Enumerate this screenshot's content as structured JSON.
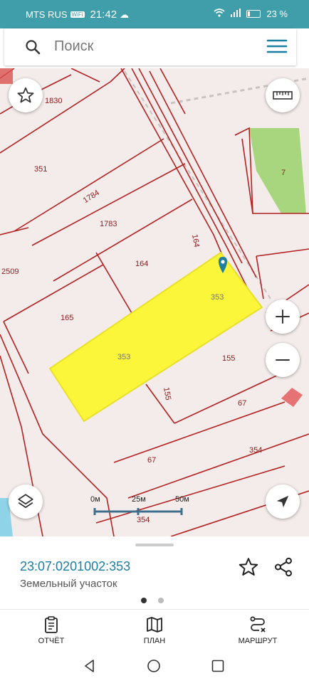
{
  "status": {
    "carrier": "MTS RUS",
    "wifi_badge": "WiFi",
    "time": "21:42",
    "battery": "23 %"
  },
  "search": {
    "placeholder": "Поиск"
  },
  "map": {
    "parcel_labels": [
      "1830",
      "351",
      "1784",
      "1783",
      "2509",
      "164",
      "164",
      "165",
      "353",
      "353",
      "155",
      "155",
      "67",
      "67",
      "354",
      "354",
      "7"
    ]
  },
  "scale": {
    "ticks": [
      "0м",
      "25м",
      "50м"
    ]
  },
  "sheet": {
    "cadastral_number": "23:07:0201002:353",
    "type": "Земельный участок"
  },
  "navbar": {
    "report": "ОТЧЁТ",
    "plan": "ПЛАН",
    "route": "МАРШРУТ"
  },
  "colors": {
    "accent": "#3f9ea9",
    "parcel_highlight": "#fbf63a",
    "boundary": "#b22222",
    "link": "#1a7ea0"
  }
}
